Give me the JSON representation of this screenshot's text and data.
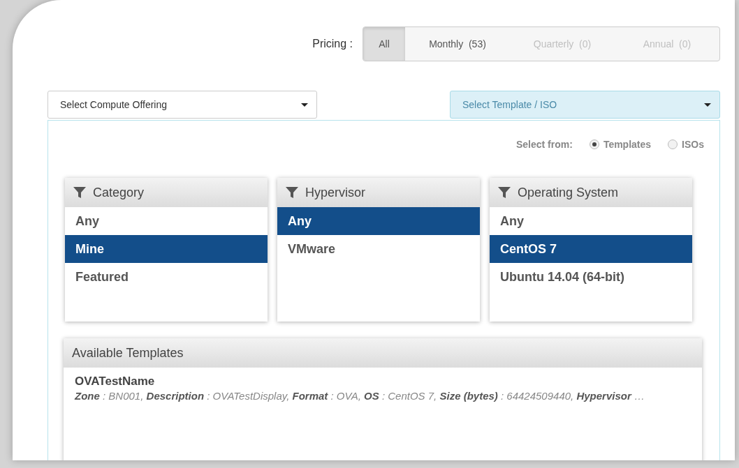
{
  "pricing": {
    "label": "Pricing :",
    "options": [
      {
        "label": "All",
        "selected": true,
        "disabled": false
      },
      {
        "label": "Monthly  (53)",
        "selected": false,
        "disabled": false
      },
      {
        "label": "Quarterly  (0)",
        "selected": false,
        "disabled": true
      },
      {
        "label": "Annual  (0)",
        "selected": false,
        "disabled": true
      }
    ]
  },
  "compute_select": {
    "placeholder": "Select Compute Offering",
    "active": false
  },
  "template_select": {
    "placeholder": "Select Template / ISO",
    "active": true
  },
  "select_from": {
    "label": "Select from:",
    "options": [
      {
        "label": "Templates",
        "selected": true
      },
      {
        "label": "ISOs",
        "selected": false
      }
    ]
  },
  "filters": [
    {
      "title": "Category",
      "items": [
        {
          "label": "Any",
          "selected": false
        },
        {
          "label": "Mine",
          "selected": true
        },
        {
          "label": "Featured",
          "selected": false
        }
      ]
    },
    {
      "title": "Hypervisor",
      "items": [
        {
          "label": "Any",
          "selected": true
        },
        {
          "label": "VMware",
          "selected": false
        }
      ]
    },
    {
      "title": "Operating System",
      "items": [
        {
          "label": "Any",
          "selected": false
        },
        {
          "label": "CentOS 7",
          "selected": true
        },
        {
          "label": "Ubuntu 14.04 (64-bit)",
          "selected": false
        }
      ]
    }
  ],
  "templates": {
    "title": "Available Templates",
    "items": [
      {
        "name": "OVATestName",
        "details": "**Zone** : BN001, **Description** : OVATestDisplay, **Format** : OVA, **OS** : CentOS 7, **Size (bytes)** : 64424509440, **Hypervisor** …"
      }
    ]
  }
}
